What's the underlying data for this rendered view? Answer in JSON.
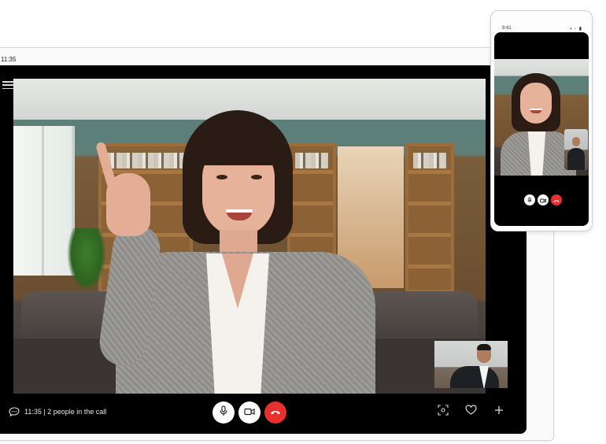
{
  "tablet": {
    "status_time": "11:35",
    "call_info": "11:35 | 2 people in the call",
    "controls": {
      "mic": "microphone-icon",
      "camera": "video-camera-icon",
      "hangup": "hang-up-icon"
    },
    "right_actions": [
      "screenshot-icon",
      "heart-icon",
      "plus-icon"
    ]
  },
  "phone": {
    "status_time": "9:41",
    "status_icons": "▪ ◦ ▮",
    "controls": {
      "mic": "microphone-icon",
      "camera": "video-camera-icon",
      "hangup": "hang-up-icon"
    }
  },
  "colors": {
    "hangup_red": "#e8302f",
    "screen_bg": "#000000",
    "control_white": "#ffffff"
  }
}
